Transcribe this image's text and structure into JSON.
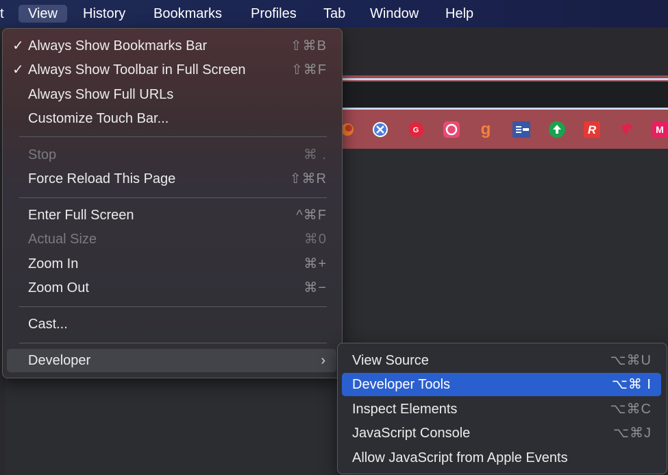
{
  "menubar": {
    "items": [
      "t",
      "View",
      "History",
      "Bookmarks",
      "Profiles",
      "Tab",
      "Window",
      "Help"
    ],
    "active": "View"
  },
  "view_menu": {
    "items": [
      {
        "check": "✓",
        "label": "Always Show Bookmarks Bar",
        "shortcut": "⇧⌘B"
      },
      {
        "check": "✓",
        "label": "Always Show Toolbar in Full Screen",
        "shortcut": "⇧⌘F"
      },
      {
        "check": "",
        "label": "Always Show Full URLs",
        "shortcut": ""
      },
      {
        "check": "",
        "label": "Customize Touch Bar...",
        "shortcut": ""
      },
      {
        "check": "",
        "label": "Stop",
        "shortcut": "⌘ .",
        "disabled": true
      },
      {
        "check": "",
        "label": "Force Reload This Page",
        "shortcut": "⇧⌘R"
      },
      {
        "check": "",
        "label": "Enter Full Screen",
        "shortcut": "^⌘F"
      },
      {
        "check": "",
        "label": "Actual Size",
        "shortcut": "⌘0",
        "disabled": true
      },
      {
        "check": "",
        "label": "Zoom In",
        "shortcut": "⌘+"
      },
      {
        "check": "",
        "label": "Zoom Out",
        "shortcut": "⌘−"
      },
      {
        "check": "",
        "label": "Cast...",
        "shortcut": ""
      },
      {
        "check": "",
        "label": "Developer",
        "shortcut": "",
        "submenu": true,
        "arrow": "›"
      }
    ]
  },
  "developer_menu": {
    "items": [
      {
        "label": "View Source",
        "shortcut": "⌥⌘U"
      },
      {
        "label": "Developer Tools",
        "shortcut": "⌥⌘ I",
        "selected": true
      },
      {
        "label": "Inspect Elements",
        "shortcut": "⌥⌘C"
      },
      {
        "label": "JavaScript Console",
        "shortcut": "⌥⌘J"
      },
      {
        "label": "Allow JavaScript from Apple Events",
        "shortcut": ""
      }
    ]
  },
  "bookmarks": [
    {
      "icon": "firefox-icon",
      "glyph": "",
      "color": "#e8682a"
    },
    {
      "icon": "safari-x-icon",
      "glyph": "✕",
      "color": "#3b6fd6"
    },
    {
      "icon": "grammarly-icon",
      "glyph": "G",
      "color": "#d7263d"
    },
    {
      "icon": "lifebuoy-icon",
      "glyph": "◎",
      "color": "#e3466b"
    },
    {
      "icon": "goodreads-g-icon",
      "glyph": "g",
      "color": "#f26b2a"
    },
    {
      "icon": "reader-icon",
      "glyph": "≡",
      "color": "#3557a8"
    },
    {
      "icon": "upload-cloud-icon",
      "glyph": "▲",
      "color": "#18a84e"
    },
    {
      "icon": "r-icon",
      "glyph": "R",
      "color": "#e53935"
    },
    {
      "icon": "pin-icon",
      "glyph": "◆",
      "color": "#e0204a"
    },
    {
      "icon": "m-icon",
      "glyph": "M",
      "color": "#e91e63"
    }
  ]
}
